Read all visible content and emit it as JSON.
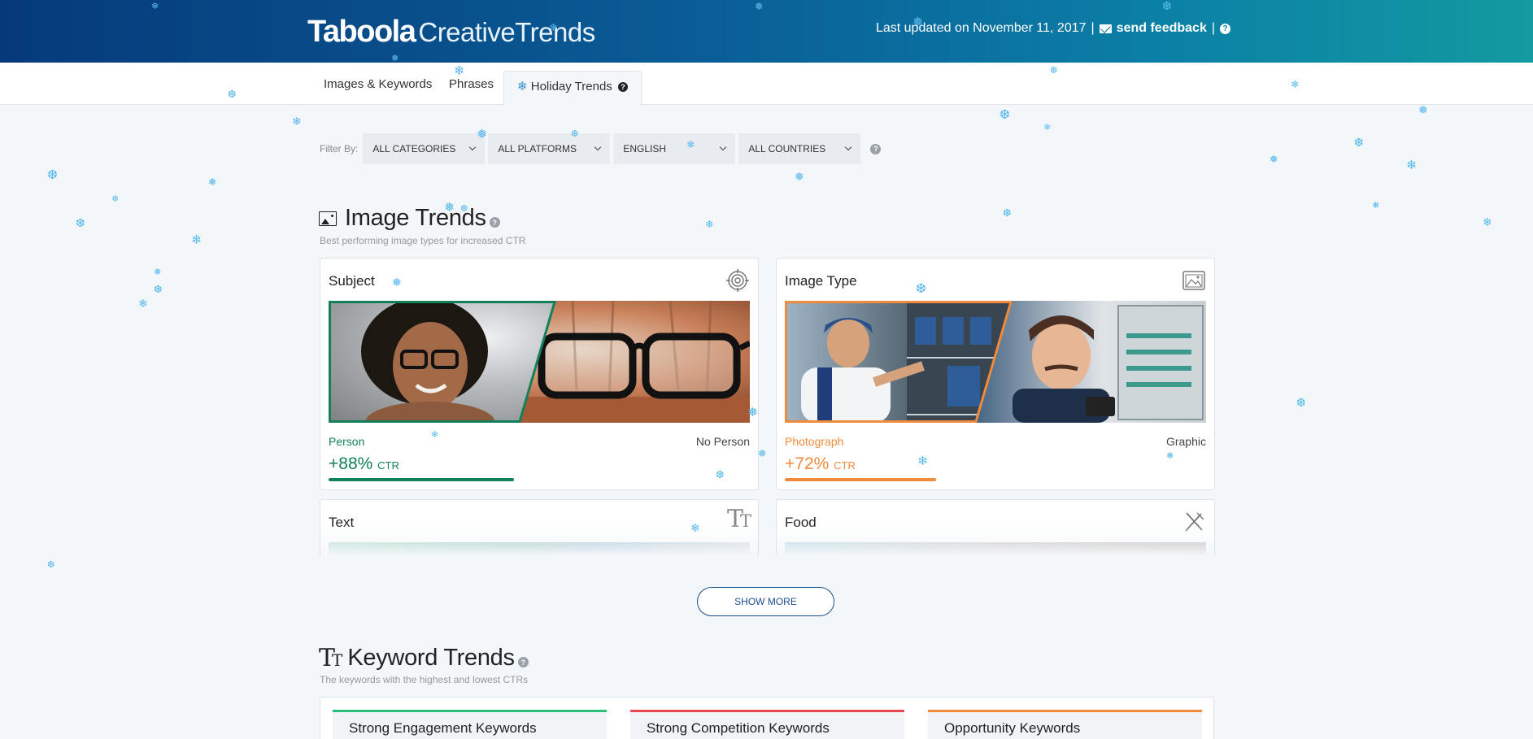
{
  "header": {
    "logo_brand": "Taboola",
    "logo_product": "CreativeTrends",
    "updated": "Last updated on November 11, 2017",
    "separator": "|",
    "feedback": "send feedback"
  },
  "tabs": [
    {
      "label": "Images & Keywords"
    },
    {
      "label": "Phrases"
    },
    {
      "label": "Holiday Trends"
    }
  ],
  "filters": {
    "label": "Filter By:",
    "selects": [
      "ALL CATEGORIES",
      "ALL PLATFORMS",
      "ENGLISH",
      "ALL COUNTRIES"
    ]
  },
  "image_trends": {
    "title": "Image Trends",
    "subtitle": "Best performing image types for increased CTR",
    "cards": [
      {
        "title": "Subject",
        "left_label": "Person",
        "right_label": "No Person",
        "ctr_value": "+88%",
        "ctr_unit": "CTR",
        "color": "#13805a",
        "level": 0.44
      },
      {
        "title": "Image Type",
        "left_label": "Photograph",
        "right_label": "Graphic",
        "ctr_value": "+72%",
        "ctr_unit": "CTR",
        "color": "#f08a3c",
        "level": 0.36
      },
      {
        "title": "Text"
      },
      {
        "title": "Food"
      }
    ]
  },
  "show_more": "SHOW MORE",
  "keyword_trends": {
    "title": "Keyword Trends",
    "subtitle": "The keywords with the highest and lowest CTRs",
    "cards": [
      {
        "title": "Strong Engagement Keywords",
        "color": "#2bbf7e"
      },
      {
        "title": "Strong Competition Keywords",
        "color": "#e5484d"
      },
      {
        "title": "Opportunity Keywords",
        "color": "#f08a3c"
      }
    ]
  }
}
